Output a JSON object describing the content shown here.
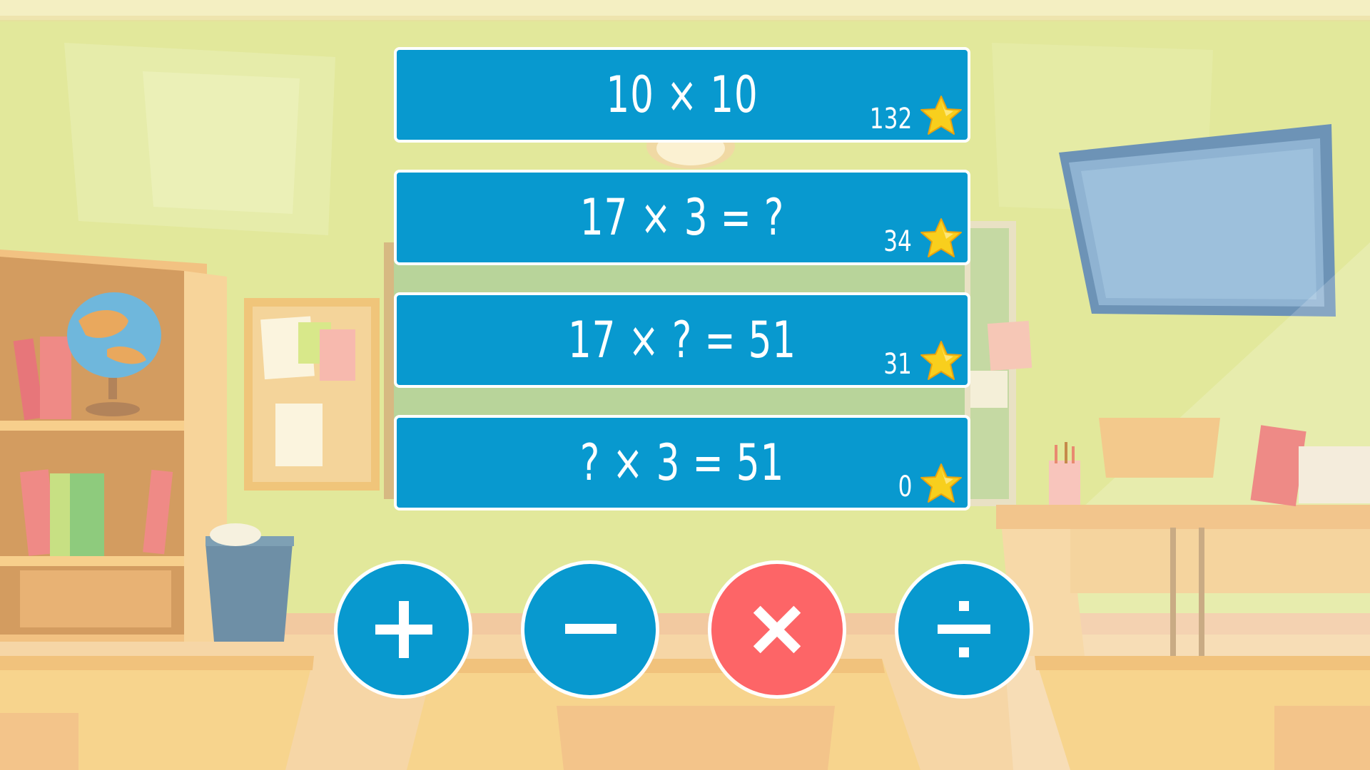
{
  "scene": {
    "background": "classroom",
    "colors": {
      "card": "#0899cf",
      "card_border": "#ffffff",
      "button": "#0899cf",
      "button_active": "#fd6567",
      "star": "#f8cf1d",
      "wall": "#e3e99a"
    }
  },
  "modes": [
    {
      "expr": "10 × 10",
      "score": "132",
      "icon": "star-icon"
    },
    {
      "expr": "17 × 3 = ?",
      "score": "34",
      "icon": "star-icon"
    },
    {
      "expr": "17 × ? = 51",
      "score": "31",
      "icon": "star-icon"
    },
    {
      "expr": "? × 3 = 51",
      "score": "0",
      "icon": "star-icon"
    }
  ],
  "operators": [
    {
      "symbol": "+",
      "icon": "plus-icon",
      "active": false
    },
    {
      "symbol": "−",
      "icon": "minus-icon",
      "active": false
    },
    {
      "symbol": "×",
      "icon": "multiply-icon",
      "active": true
    },
    {
      "symbol": "÷",
      "icon": "divide-icon",
      "active": false
    }
  ]
}
